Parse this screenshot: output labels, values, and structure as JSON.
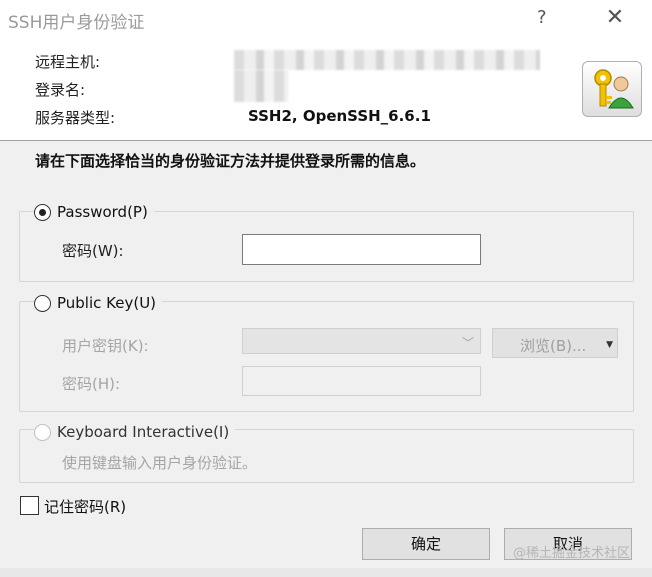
{
  "window": {
    "title": "SSH用户身份验证",
    "help": "?",
    "close": "✕"
  },
  "info": {
    "host_label": "远程主机:",
    "login_label": "登录名:",
    "server_type_label": "服务器类型:",
    "server_type_value": "SSH2, OpenSSH_6.6.1"
  },
  "instruction": "请在下面选择恰当的身份验证方法并提供登录所需的信息。",
  "password_group": {
    "radio_label": "Password(P)",
    "selected": true,
    "field_label": "密码(W):",
    "field_value": ""
  },
  "publickey_group": {
    "radio_label": "Public Key(U)",
    "selected": false,
    "userkey_label": "用户密钥(K):",
    "userkey_value": "",
    "browse_label": "浏览(B)...",
    "passphrase_label": "密码(H):",
    "passphrase_value": ""
  },
  "keyboard_group": {
    "radio_label": "Keyboard Interactive(I)",
    "selected": false,
    "hint": "使用键盘输入用户身份验证。"
  },
  "remember": {
    "label": "记住密码(R)",
    "checked": false
  },
  "buttons": {
    "ok": "确定",
    "cancel": "取消"
  },
  "watermark": "@稀土掘金技术社区",
  "icons": {
    "key_user": "key-user-icon"
  }
}
